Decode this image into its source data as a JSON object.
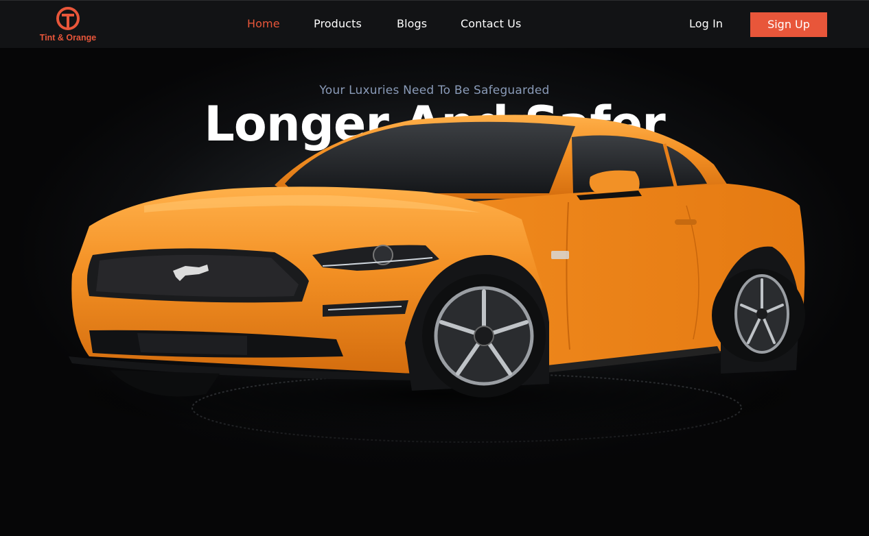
{
  "brand": {
    "name": "Tint & Orange",
    "accent": "#e8563a"
  },
  "nav": {
    "links": [
      {
        "label": "Home",
        "active": true
      },
      {
        "label": "Products",
        "active": false
      },
      {
        "label": "Blogs",
        "active": false
      },
      {
        "label": "Contact Us",
        "active": false
      }
    ],
    "login_label": "Log In",
    "signup_label": "Sign Up"
  },
  "hero": {
    "tagline": "Your Luxuries Need To Be Safeguarded",
    "headline": "Longer And Safer",
    "image": "orange-sports-car",
    "car_color": "#f08a1e",
    "background": "#060607"
  }
}
